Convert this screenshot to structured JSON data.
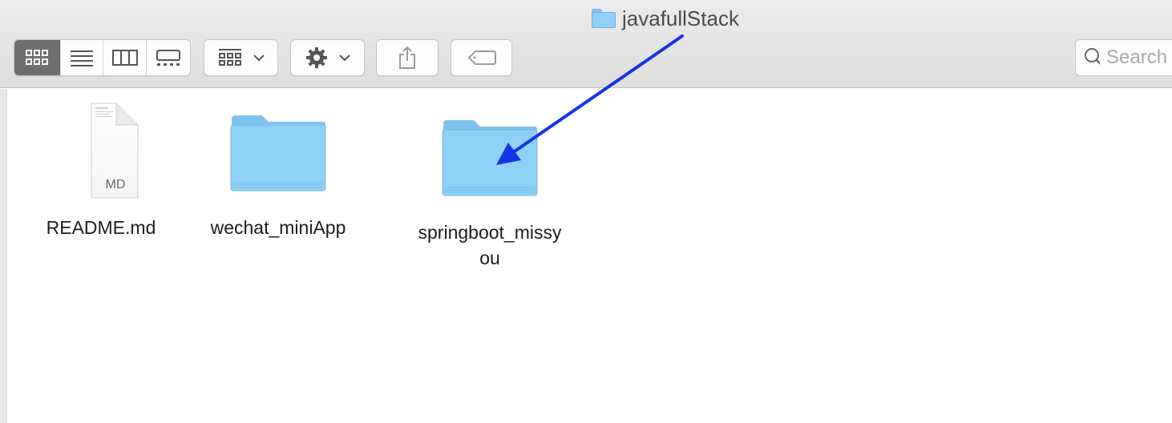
{
  "window": {
    "title": "javafullStack"
  },
  "toolbar": {
    "view_modes": [
      {
        "name": "icon-view",
        "active": true
      },
      {
        "name": "list-view",
        "active": false
      },
      {
        "name": "column-view",
        "active": false
      },
      {
        "name": "gallery-view",
        "active": false
      }
    ],
    "group_button": "group-by-icon",
    "action_button": "gear-icon",
    "share_button": "share-icon",
    "tags_button": "tag-icon"
  },
  "search": {
    "placeholder": "Search"
  },
  "files": [
    {
      "name": "README.md",
      "kind": "document",
      "ext": "MD"
    },
    {
      "name": "wechat_miniApp",
      "kind": "folder"
    },
    {
      "name": "springboot_missy",
      "name_line2": "ou",
      "kind": "folder"
    }
  ],
  "colors": {
    "arrow": "#1535e8",
    "folder": "#8fd0f6"
  }
}
